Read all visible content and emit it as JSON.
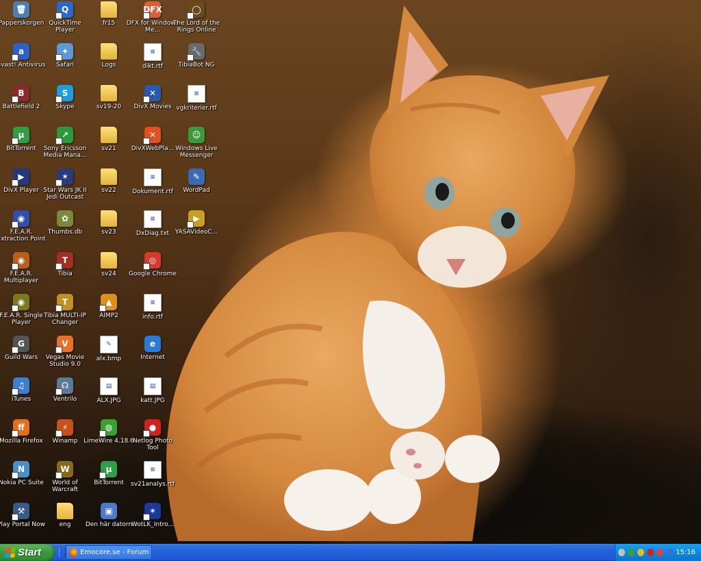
{
  "desktop": {
    "columns": [
      [
        {
          "label": "Papperskorgen",
          "symbol": "🗑",
          "kind": "app",
          "color": "#4a7fb0",
          "shortcut": false
        },
        {
          "label": "avast! Antivirus",
          "symbol": "a",
          "kind": "app",
          "color": "#2a63c8",
          "shortcut": true
        },
        {
          "label": "Battlefield 2",
          "symbol": "B",
          "kind": "app",
          "color": "#8a2a2a",
          "shortcut": true
        },
        {
          "label": "BitTorrent",
          "symbol": "µ",
          "kind": "app",
          "color": "#2ea043",
          "shortcut": true
        },
        {
          "label": "DivX Player",
          "symbol": "▶",
          "kind": "app",
          "color": "#223a7a",
          "shortcut": true
        },
        {
          "label": "F.E.A.R. Extraction Point",
          "symbol": "◉",
          "kind": "app",
          "color": "#3050b0",
          "shortcut": true
        },
        {
          "label": "F.E.A.R. Multiplayer",
          "symbol": "◉",
          "kind": "app",
          "color": "#b8601a",
          "shortcut": true
        },
        {
          "label": "F.E.A.R. Single Player",
          "symbol": "◉",
          "kind": "app",
          "color": "#7a7a20",
          "shortcut": true
        },
        {
          "label": "Guild Wars",
          "symbol": "G",
          "kind": "app",
          "color": "#555555",
          "shortcut": true
        },
        {
          "label": "iTunes",
          "symbol": "♫",
          "kind": "app",
          "color": "#3a80d0",
          "shortcut": true
        },
        {
          "label": "Mozilla Firefox",
          "symbol": "ff",
          "kind": "app",
          "color": "#e0701a",
          "shortcut": true
        },
        {
          "label": "Nokia PC Suite",
          "symbol": "N",
          "kind": "app",
          "color": "#4a90c8",
          "shortcut": true
        },
        {
          "label": "Play Portal Now",
          "symbol": "⚒",
          "kind": "app",
          "color": "#3a5a8a",
          "shortcut": true
        }
      ],
      [
        {
          "label": "QuickTime Player",
          "symbol": "Q",
          "kind": "app",
          "color": "#2a6ad0",
          "shortcut": true
        },
        {
          "label": "Safari",
          "symbol": "✦",
          "kind": "app",
          "color": "#5a9ad8",
          "shortcut": true
        },
        {
          "label": "Skype",
          "symbol": "S",
          "kind": "app",
          "color": "#1aa0e0",
          "shortcut": true
        },
        {
          "label": "Sony Ericsson Media Mana...",
          "symbol": "↗",
          "kind": "app",
          "color": "#2a9a3a",
          "shortcut": true
        },
        {
          "label": "Star Wars JK II Jedi Outcast",
          "symbol": "✶",
          "kind": "app",
          "color": "#2a3a7a",
          "shortcut": true
        },
        {
          "label": "Thumbs.db",
          "symbol": "✿",
          "kind": "app",
          "color": "#7a8a3a",
          "shortcut": false
        },
        {
          "label": "Tibia",
          "symbol": "T",
          "kind": "app",
          "color": "#a03020",
          "shortcut": true
        },
        {
          "label": "Tibia MULTI-IP Changer",
          "symbol": "T",
          "kind": "app",
          "color": "#c09020",
          "shortcut": true
        },
        {
          "label": "Vegas Movie Studio 9.0",
          "symbol": "V",
          "kind": "app",
          "color": "#e8702a",
          "shortcut": true
        },
        {
          "label": "Ventrilo",
          "symbol": "☊",
          "kind": "app",
          "color": "#5a7a9a",
          "shortcut": true
        },
        {
          "label": "Winamp",
          "symbol": "⚡",
          "kind": "app",
          "color": "#c8501a",
          "shortcut": true
        },
        {
          "label": "World of Warcraft",
          "symbol": "W",
          "kind": "app",
          "color": "#8a6a1a",
          "shortcut": true
        },
        {
          "label": "eng",
          "symbol": "",
          "kind": "folder",
          "color": "#e8b840",
          "shortcut": false
        }
      ],
      [
        {
          "label": "fr15",
          "symbol": "",
          "kind": "folder",
          "color": "#e8b840",
          "shortcut": false
        },
        {
          "label": "Logs",
          "symbol": "",
          "kind": "folder",
          "color": "#e8b840",
          "shortcut": false
        },
        {
          "label": "sv19-20",
          "symbol": "",
          "kind": "folder",
          "color": "#e8b840",
          "shortcut": false
        },
        {
          "label": "sv21",
          "symbol": "",
          "kind": "folder",
          "color": "#e8b840",
          "shortcut": false
        },
        {
          "label": "sv22",
          "symbol": "",
          "kind": "folder",
          "color": "#e8b840",
          "shortcut": false
        },
        {
          "label": "sv23",
          "symbol": "",
          "kind": "folder",
          "color": "#e8b840",
          "shortcut": false
        },
        {
          "label": "sv24",
          "symbol": "",
          "kind": "folder",
          "color": "#e8b840",
          "shortcut": false
        },
        {
          "label": "AIMP2",
          "symbol": "▲",
          "kind": "app",
          "color": "#e0901a",
          "shortcut": true
        },
        {
          "label": "alx.bmp",
          "symbol": "✎",
          "kind": "doc",
          "color": "#ffffff",
          "shortcut": false
        },
        {
          "label": "ALX.JPG",
          "symbol": "▤",
          "kind": "doc",
          "color": "#ffffff",
          "shortcut": false
        },
        {
          "label": "LimeWire 4.18.6",
          "symbol": "◍",
          "kind": "app",
          "color": "#3aa030",
          "shortcut": true
        },
        {
          "label": "BitTorrent",
          "symbol": "µ",
          "kind": "app",
          "color": "#2ea043",
          "shortcut": true
        },
        {
          "label": "Den här datorn",
          "symbol": "▣",
          "kind": "app",
          "color": "#4a7ac8",
          "shortcut": false
        }
      ],
      [
        {
          "label": "DFX for Windows Me...",
          "symbol": "DFX",
          "kind": "app",
          "color": "#d8603a",
          "shortcut": true
        },
        {
          "label": "dikt.rtf",
          "symbol": "≡",
          "kind": "doc",
          "color": "#ffffff",
          "shortcut": false
        },
        {
          "label": "DivX Movies",
          "symbol": "✕",
          "kind": "app",
          "color": "#2a5ab0",
          "shortcut": true
        },
        {
          "label": "DivXWebPla...",
          "symbol": "✕",
          "kind": "app",
          "color": "#e05020",
          "shortcut": true
        },
        {
          "label": "Dokument.rtf",
          "symbol": "≡",
          "kind": "doc",
          "color": "#ffffff",
          "shortcut": false
        },
        {
          "label": "DxDiag.txt",
          "symbol": "≡",
          "kind": "doc",
          "color": "#ffffff",
          "shortcut": false
        },
        {
          "label": "Google Chrome",
          "symbol": "◎",
          "kind": "app",
          "color": "#d83a2a",
          "shortcut": true
        },
        {
          "label": "info.rtf",
          "symbol": "≡",
          "kind": "doc",
          "color": "#ffffff",
          "shortcut": false
        },
        {
          "label": "Internet",
          "symbol": "e",
          "kind": "app",
          "color": "#2a7ad8",
          "shortcut": false
        },
        {
          "label": "katt.JPG",
          "symbol": "▤",
          "kind": "doc",
          "color": "#ffffff",
          "shortcut": false
        },
        {
          "label": "Netlog Photo Tool",
          "symbol": "●",
          "kind": "app",
          "color": "#d02020",
          "shortcut": true
        },
        {
          "label": "sv21analys.rtf",
          "symbol": "≡",
          "kind": "doc",
          "color": "#ffffff",
          "shortcut": false
        },
        {
          "label": "WotLK_Intro...",
          "symbol": "✶",
          "kind": "app",
          "color": "#1a3a9a",
          "shortcut": true
        }
      ],
      [
        {
          "label": "The Lord of the Rings Online",
          "symbol": "◯",
          "kind": "app",
          "color": "#6a4a1a",
          "shortcut": true
        },
        {
          "label": "TibiaBot NG",
          "symbol": "🔧",
          "kind": "app",
          "color": "#6a6a6a",
          "shortcut": true
        },
        {
          "label": "vgkriterier.rtf",
          "symbol": "≡",
          "kind": "doc",
          "color": "#ffffff",
          "shortcut": false
        },
        {
          "label": "Windows Live Messenger",
          "symbol": "☺",
          "kind": "app",
          "color": "#3a9a3a",
          "shortcut": false
        },
        {
          "label": "WordPad",
          "symbol": "✎",
          "kind": "app",
          "color": "#3a6ab0",
          "shortcut": false
        },
        {
          "label": "YASAVideoC...",
          "symbol": "▶",
          "kind": "app",
          "color": "#c8a020",
          "shortcut": true
        }
      ]
    ]
  },
  "taskbar": {
    "start_label": "Start",
    "task_label": "Emocore.se - Forum - ...",
    "clock": "15:16",
    "tray_colors": [
      "#c0c0c0",
      "#3aa030",
      "#e0c020",
      "#d02020",
      "#e04040",
      "#3a70d0"
    ]
  }
}
